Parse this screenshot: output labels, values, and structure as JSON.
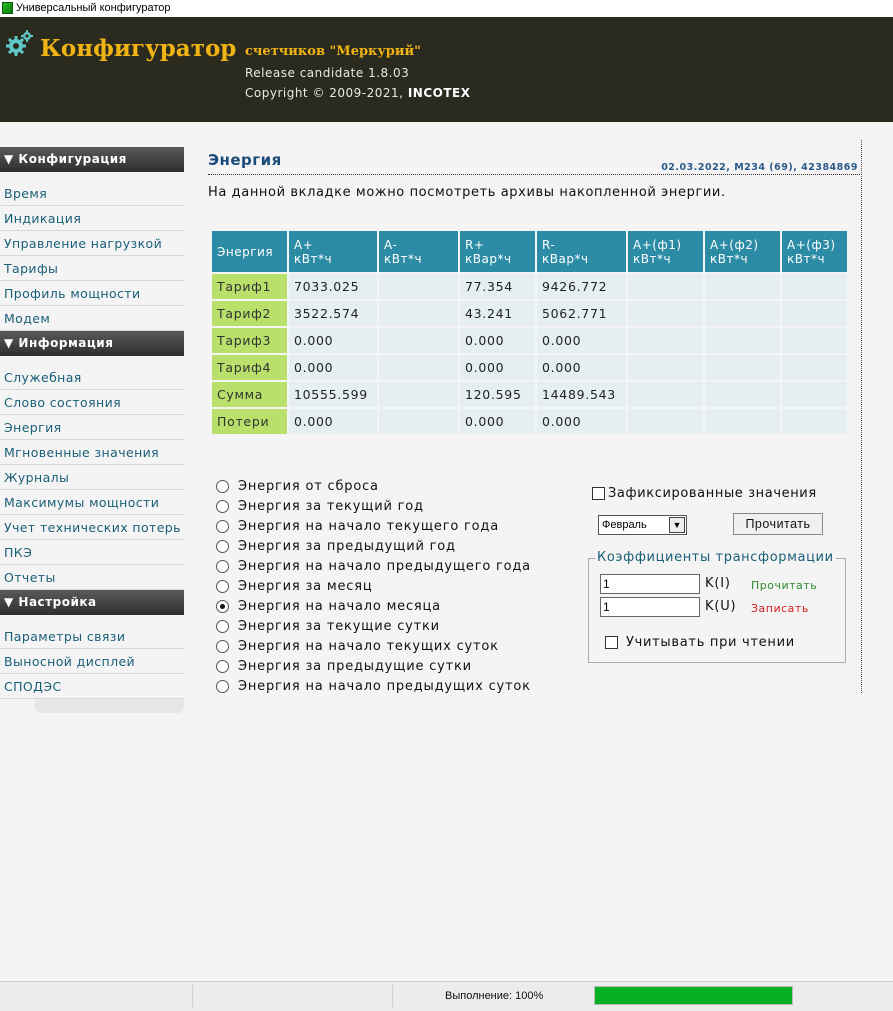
{
  "window": {
    "title": "Универсальный конфигуратор"
  },
  "header": {
    "title": "Конфигуратор",
    "subtitle": "счетчиков \"Меркурий\"",
    "version": "Release candidate 1.8.03",
    "copyright_prefix": "Copyright © 2009-2021,",
    "company": "INCOTEX"
  },
  "sidebar": {
    "sections": [
      {
        "title": "▼ Конфигурация",
        "items": [
          "Время",
          "Индикация",
          "Управление нагрузкой",
          "Тарифы",
          "Профиль мощности",
          "Модем"
        ]
      },
      {
        "title": "▼ Информация",
        "items": [
          "Служебная",
          "Слово состояния",
          "Энергия",
          "Мгновенные значения",
          "Журналы",
          "Максимумы мощности",
          "Учет технических потерь",
          "ПКЭ",
          "Отчеты"
        ]
      },
      {
        "title": "▼ Настройка",
        "items": [
          "Параметры связи",
          "Выносной дисплей",
          "СПОДЭС"
        ]
      }
    ]
  },
  "page": {
    "title": "Энергия",
    "meta": "02.03.2022, M234 (69), 42384869",
    "description": "На данной вкладке можно посмотреть архивы накопленной энергии."
  },
  "table": {
    "columns": [
      [
        "Энергия",
        ""
      ],
      [
        "A+",
        "кВт*ч"
      ],
      [
        "A-",
        "кВт*ч"
      ],
      [
        "R+",
        "кВар*ч"
      ],
      [
        "R-",
        "кВар*ч"
      ],
      [
        "A+(ф1)",
        "кВт*ч"
      ],
      [
        "A+(ф2)",
        "кВт*ч"
      ],
      [
        "A+(ф3)",
        "кВт*ч"
      ]
    ],
    "rows": [
      [
        "Тариф1",
        "7033.025",
        "",
        "77.354",
        "9426.772",
        "",
        "",
        ""
      ],
      [
        "Тариф2",
        "3522.574",
        "",
        "43.241",
        "5062.771",
        "",
        "",
        ""
      ],
      [
        "Тариф3",
        "0.000",
        "",
        "0.000",
        "0.000",
        "",
        "",
        ""
      ],
      [
        "Тариф4",
        "0.000",
        "",
        "0.000",
        "0.000",
        "",
        "",
        ""
      ],
      [
        "Сумма",
        "10555.599",
        "",
        "120.595",
        "14489.543",
        "",
        "",
        ""
      ],
      [
        "Потери",
        "0.000",
        "",
        "0.000",
        "0.000",
        "",
        "",
        ""
      ]
    ]
  },
  "radio_options": [
    "Энергия от сброса",
    "Энергия за текущий год",
    "Энергия на начало текущего года",
    "Энергия за предыдущий год",
    "Энергия на начало предыдущего года",
    "Энергия за месяц",
    "Энергия на начало месяца",
    "Энергия за текущие сутки",
    "Энергия на начало текущих суток",
    "Энергия за предыдущие сутки",
    "Энергия на начало предыдущих суток"
  ],
  "selected_radio_index": 6,
  "controls": {
    "fixed_values_label": "Зафиксированные значения",
    "fixed_values_checked": false,
    "month_selected": "Февраль",
    "read_button": "Прочитать"
  },
  "transform": {
    "legend": "Коэффициенты трансформации",
    "ki_value": "1",
    "ki_label": "K(I)",
    "ku_value": "1",
    "ku_label": "K(U)",
    "read_link": "Прочитать",
    "write_link": "Записать",
    "apply_label": "Учитывать при чтении",
    "apply_checked": false
  },
  "status": {
    "text": "Выполнение: 100%",
    "progress": 1.0,
    "progress_color": "#06b025"
  }
}
